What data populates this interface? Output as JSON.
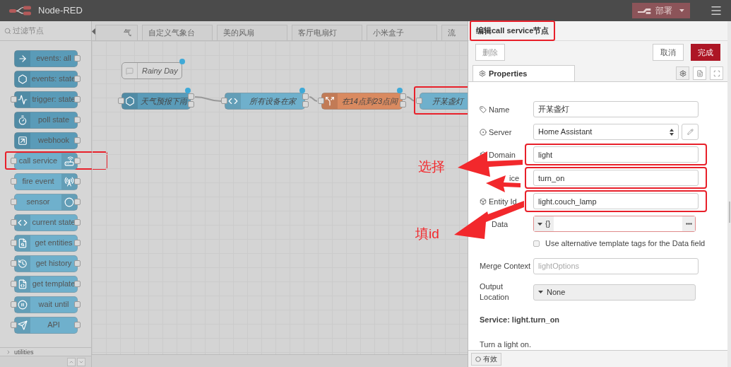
{
  "header": {
    "title": "Node-RED",
    "deploy": {
      "label": "部署"
    }
  },
  "palette": {
    "filter_placeholder": "过滤节点",
    "nodes": [
      {
        "label": "events: all",
        "color": "#5a9bb8",
        "highlighted": false
      },
      {
        "label": "events: state",
        "color": "#5a9bb8",
        "highlighted": false
      },
      {
        "label": "trigger: state",
        "color": "#5a9bb8",
        "highlighted": false
      },
      {
        "label": "poll state",
        "color": "#5a9bb8",
        "highlighted": false
      },
      {
        "label": "webhook",
        "color": "#5a9bb8",
        "highlighted": false
      },
      {
        "label": "call service",
        "color": "#6fb0cc",
        "highlighted": true
      },
      {
        "label": "fire event",
        "color": "#6fb0cc",
        "highlighted": false
      },
      {
        "label": "sensor",
        "color": "#6fb0cc",
        "highlighted": false
      },
      {
        "label": "current state",
        "color": "#6fb0cc",
        "highlighted": false
      },
      {
        "label": "get entities",
        "color": "#6fb0cc",
        "highlighted": false
      },
      {
        "label": "get history",
        "color": "#6fb0cc",
        "highlighted": false
      },
      {
        "label": "get template",
        "color": "#6fb0cc",
        "highlighted": false
      },
      {
        "label": "wait until",
        "color": "#6fb0cc",
        "highlighted": false
      },
      {
        "label": "API",
        "color": "#6fb0cc",
        "highlighted": false
      }
    ],
    "category": "utilities"
  },
  "tabs": [
    {
      "label": "气",
      "selected": false
    },
    {
      "label": "自定义气象台",
      "selected": false
    },
    {
      "label": "美的风扇",
      "selected": false
    },
    {
      "label": "客厅电扇灯",
      "selected": false
    },
    {
      "label": "小米盒子",
      "selected": false
    },
    {
      "label": "流",
      "selected": false
    }
  ],
  "canvas": {
    "comment": {
      "label": "Rainy Day"
    },
    "flow_nodes": [
      {
        "label": "天气预报下雨",
        "color": "#5a9bb8",
        "changed": true,
        "highlighted": false
      },
      {
        "label": "所有设备在家",
        "color": "#6fb0cc",
        "changed": true,
        "highlighted": false
      },
      {
        "label": "在14点到23点间",
        "color": "#d98a60",
        "changed": true,
        "highlighted": false
      },
      {
        "label": "开某盏灯",
        "color": "#6fb0cc",
        "changed": false,
        "highlighted": true
      }
    ]
  },
  "editor": {
    "title": {
      "text": "编辑call service节点",
      "highlighted": true
    },
    "buttons": {
      "delete": "删除",
      "cancel": "取消",
      "done": "完成"
    },
    "tab": {
      "label": "Properties"
    },
    "fields": [
      {
        "kind": "text",
        "label": "Name",
        "value": "开某盏灯",
        "highlighted": false
      },
      {
        "kind": "server",
        "label": "Server",
        "value": "Home Assistant"
      },
      {
        "kind": "text",
        "label": "Domain",
        "value": "light",
        "highlighted": true
      },
      {
        "kind": "text",
        "label": "ice",
        "value": "turn_on",
        "highlighted": true
      },
      {
        "kind": "text",
        "label": "Entity Id",
        "value": "light.couch_lamp",
        "highlighted": true
      },
      {
        "kind": "typed",
        "label": "Data",
        "value": "{}"
      },
      {
        "kind": "checkbox",
        "label": "Use alternative template tags for the Data field",
        "checked": false
      },
      {
        "kind": "placeholder",
        "label": "Merge Context",
        "placeholder": "lightOptions"
      },
      {
        "kind": "select",
        "label": "Output Location",
        "value": "None"
      }
    ],
    "service_title": "Service: light.turn_on",
    "service_desc": "Turn a light on.",
    "status": {
      "label": "有效"
    }
  },
  "annotations": [
    {
      "text": "选择"
    },
    {
      "text": "填id"
    }
  ]
}
